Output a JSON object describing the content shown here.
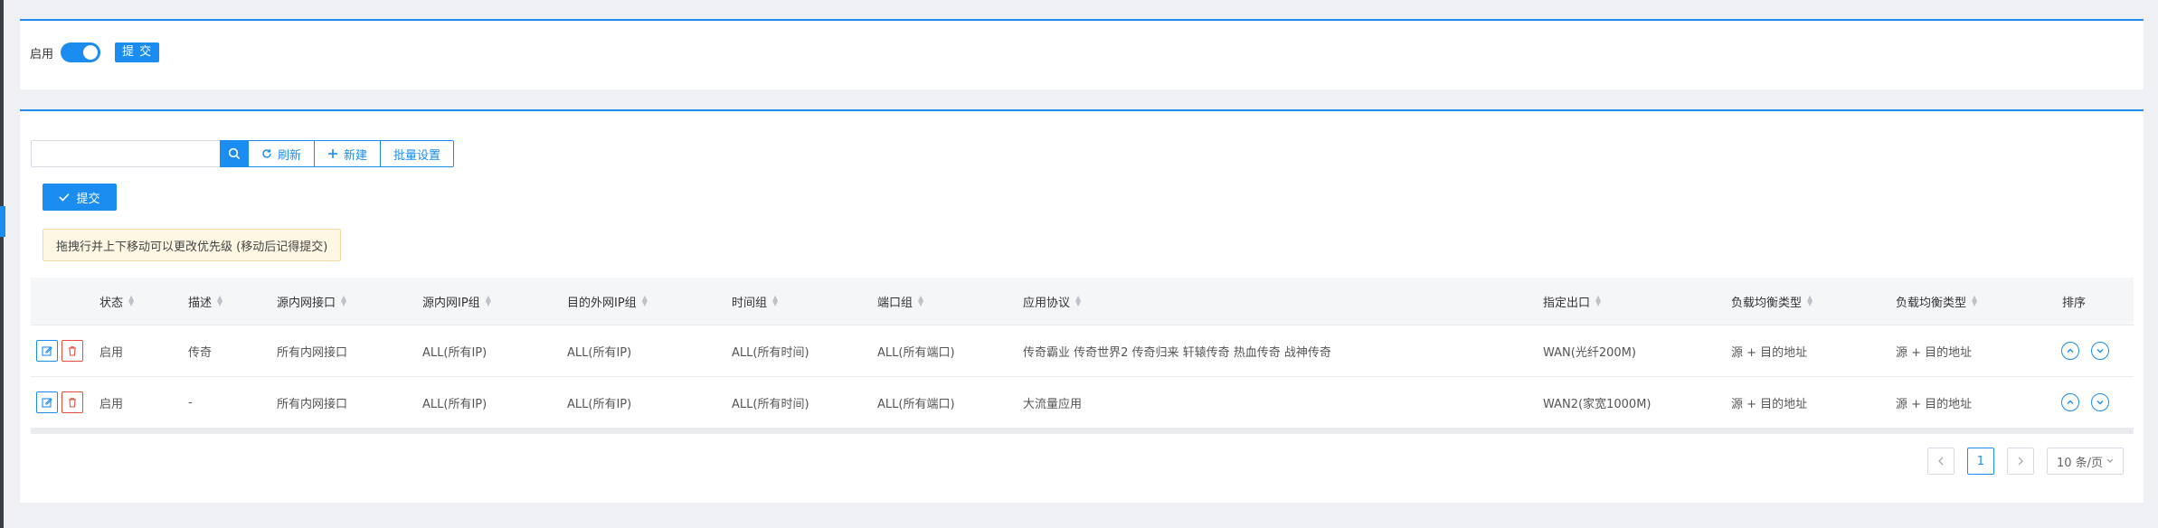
{
  "top": {
    "enable_label": "启用",
    "submit_label": "提 交"
  },
  "toolbar": {
    "search_placeholder": "",
    "refresh_label": "刷新",
    "new_label": "新建",
    "batch_label": "批量设置"
  },
  "submit2_label": "提交",
  "notice": "拖拽行并上下移动可以更改优先级 (移动后记得提交)",
  "table": {
    "headers": [
      "状态",
      "描述",
      "源内网接口",
      "源内网IP组",
      "目的外网IP组",
      "时间组",
      "端口组",
      "应用协议",
      "指定出口",
      "负载均衡类型",
      "负载均衡类型",
      "排序"
    ],
    "rows": [
      [
        "启用",
        "传奇",
        "所有内网接口",
        "ALL(所有IP)",
        "ALL(所有IP)",
        "ALL(所有时间)",
        "ALL(所有端口)",
        "传奇霸业 传奇世界2 传奇归来 轩辕传奇 热血传奇 战神传奇",
        "WAN(光纤200M)",
        "源 + 目的地址",
        "源 + 目的地址"
      ],
      [
        "启用",
        "-",
        "所有内网接口",
        "ALL(所有IP)",
        "ALL(所有IP)",
        "ALL(所有时间)",
        "ALL(所有端口)",
        "大流量应用",
        "WAN2(家宽1000M)",
        "源 + 目的地址",
        "源 + 目的地址"
      ]
    ]
  },
  "pager": {
    "current": "1",
    "page_size": "10 条/页"
  },
  "colors": {
    "accent": "#1b8df0",
    "danger": "#e74c3c",
    "notice_bg": "#fdf7e4"
  }
}
